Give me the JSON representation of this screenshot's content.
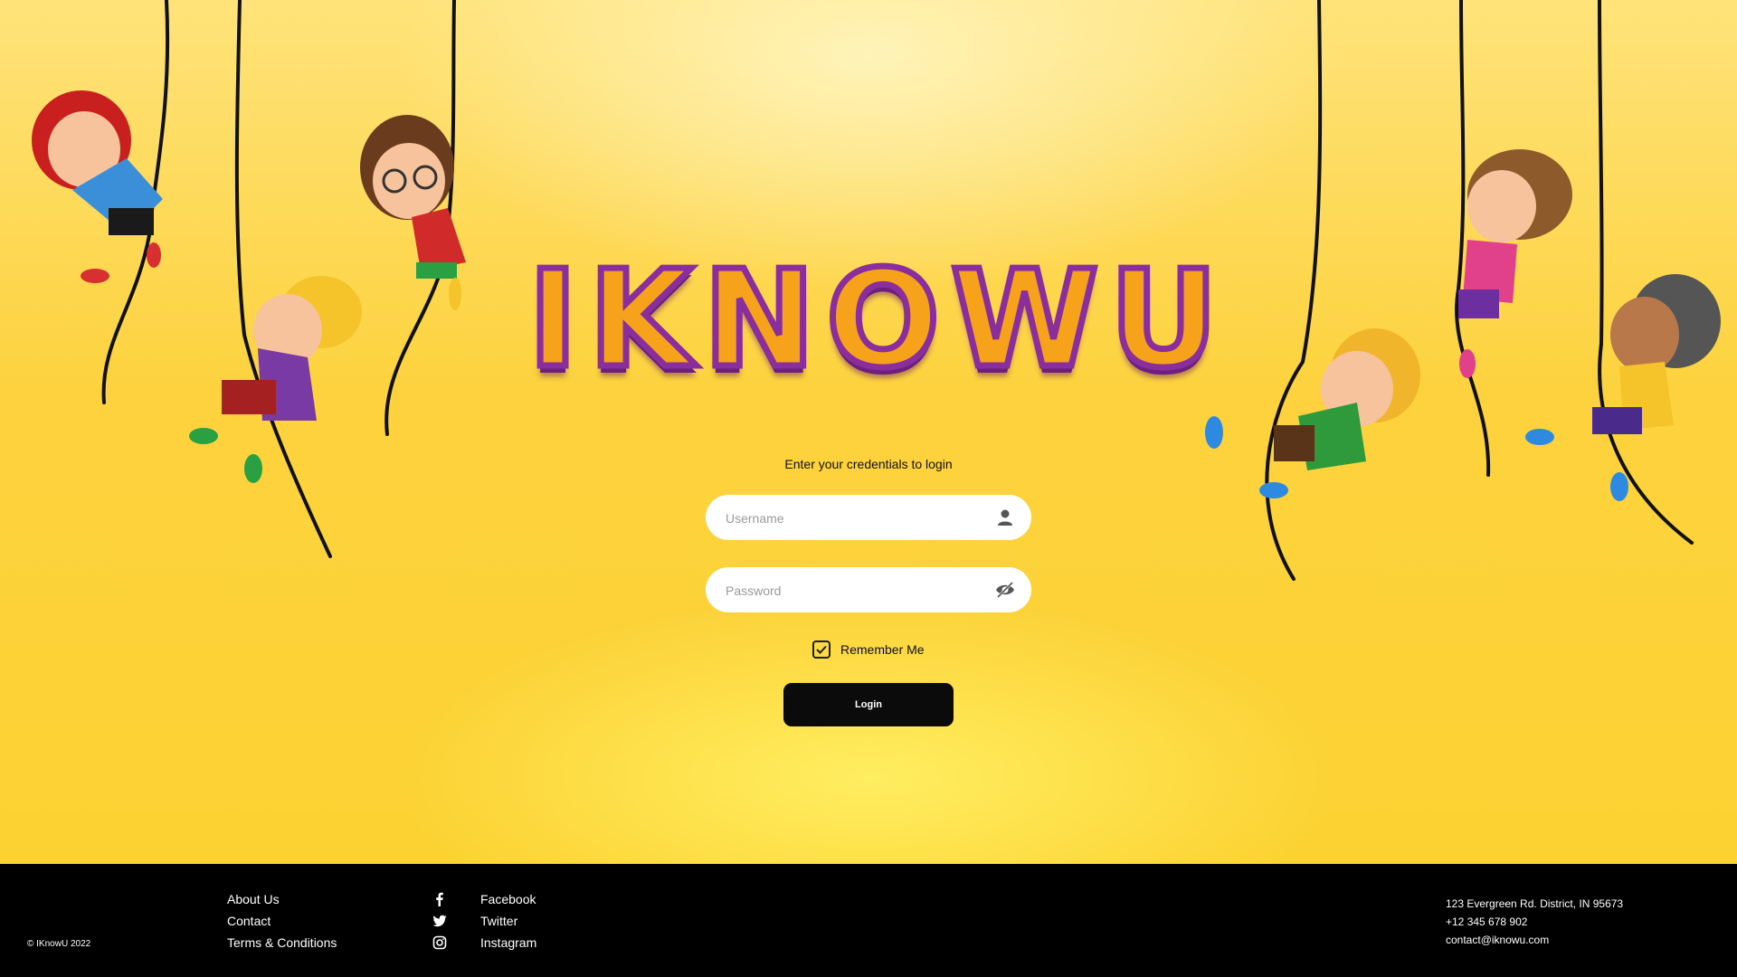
{
  "logo": {
    "text": "IKNOWU"
  },
  "login": {
    "prompt": "Enter your credentials to login",
    "username_placeholder": "Username",
    "password_placeholder": "Password",
    "remember_label": "Remember Me",
    "remember_checked": true,
    "login_label": "Login"
  },
  "footer": {
    "copyright": "© IKnowU 2022",
    "links": [
      "About Us",
      "Contact",
      "Terms & Conditions"
    ],
    "social": [
      {
        "label": "Facebook",
        "icon": "facebook-icon"
      },
      {
        "label": "Twitter",
        "icon": "twitter-icon"
      },
      {
        "label": "Instagram",
        "icon": "instagram-icon"
      }
    ],
    "address": "123 Evergreen Rd. District, IN 95673",
    "phone": "+12 345 678 902",
    "email": "contact@iknowu.com"
  },
  "colors": {
    "background": "#fcd232",
    "footer": "#000000",
    "button": "#0b0b0b",
    "logo_fill": "#f7a21b",
    "logo_stroke": "#8b2e9d"
  }
}
